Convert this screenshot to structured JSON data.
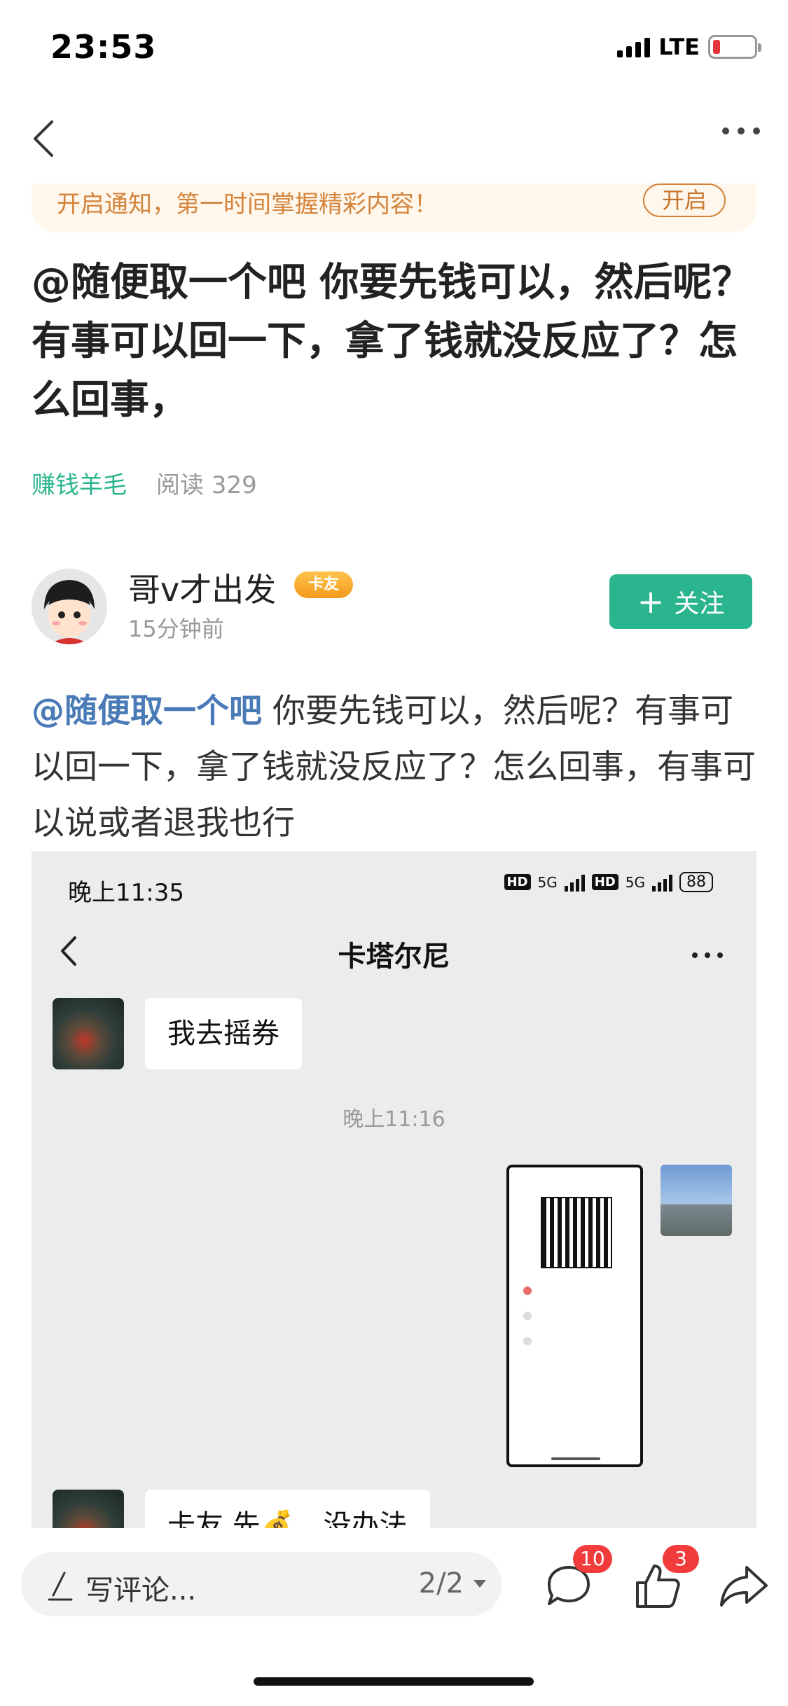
{
  "status_bar": {
    "time": "23:53",
    "network": "LTE"
  },
  "notice": {
    "text": "开启通知，第一时间掌握精彩内容！",
    "button": "开启"
  },
  "post": {
    "title": "@随便取一个吧 你要先钱可以，然后呢？有事可以回一下，拿了钱就没反应了？怎么回事，",
    "category": "赚钱羊毛",
    "reads": "阅读 329"
  },
  "author": {
    "name": "哥v才出发",
    "badge": "卡友",
    "time": "15分钟前",
    "follow_label": "关注"
  },
  "body": {
    "mention": "@随便取一个吧",
    "text": " 你要先钱可以，然后呢？有事可以回一下，拿了钱就没反应了？怎么回事，有事可以说或者退我也行"
  },
  "screenshot": {
    "status_time": "晚上11:35",
    "hd": "HD",
    "net": "5G",
    "battery": "88",
    "chat_title": "卡塔尔尼",
    "messages": [
      {
        "text": "我去摇券"
      },
      {
        "text": "卡友 先💰，没办法"
      }
    ],
    "timestamp": "晚上11:16"
  },
  "bottom": {
    "comment_placeholder": "写评论...",
    "page_indicator": "2/2",
    "comment_count": "10",
    "like_count": "3"
  },
  "colors": {
    "accent": "#2bb58e",
    "mention": "#4a7bb7",
    "notice": "#d4843b",
    "badge": "#f23b3b"
  }
}
